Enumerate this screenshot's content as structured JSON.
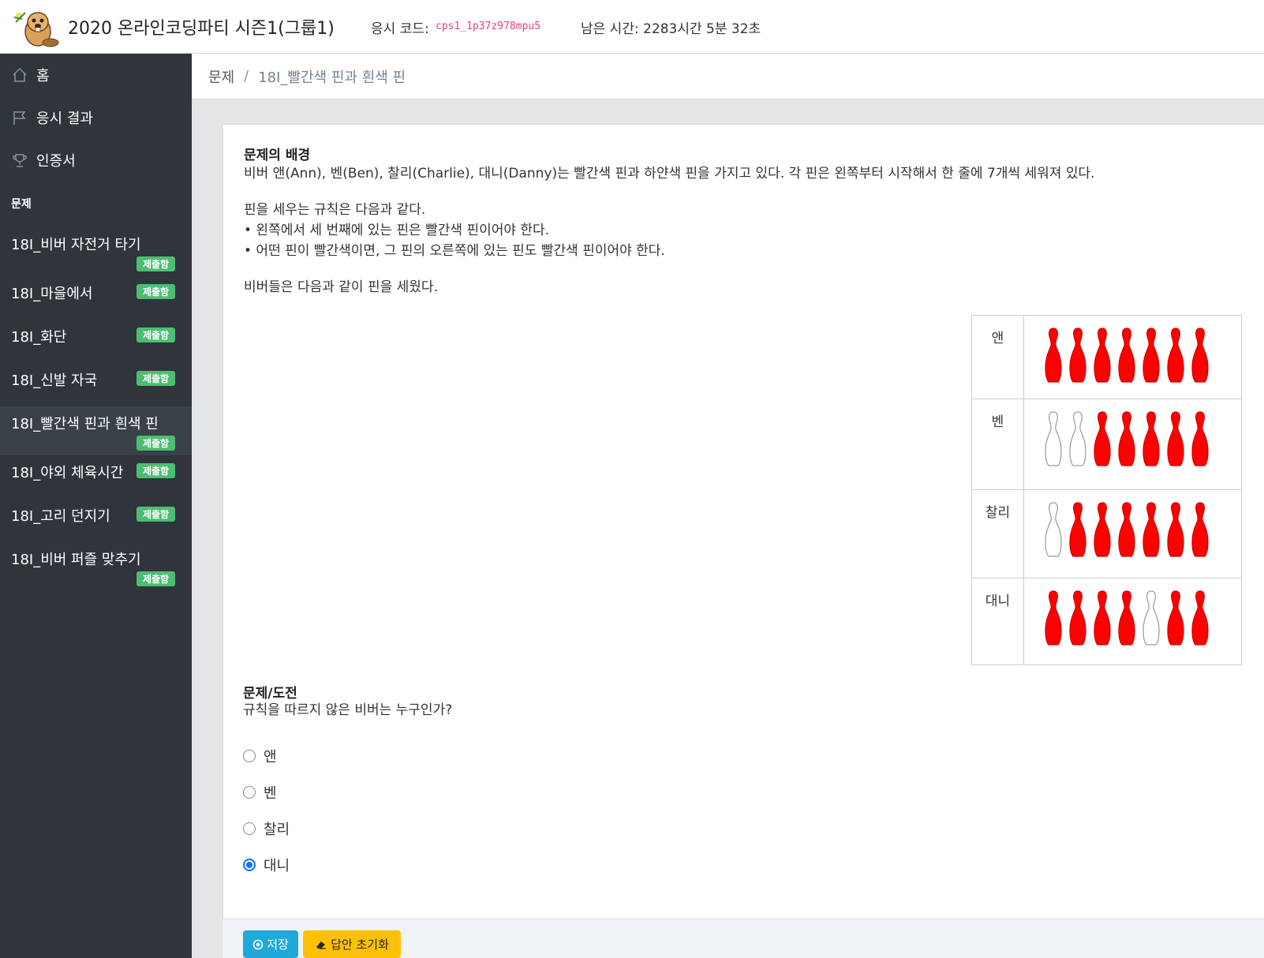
{
  "header": {
    "title": "2020 온라인코딩파티 시즌1(그룹1)",
    "code_label": "응시 코드:",
    "code_value": "cps1_1p37z978mpu5",
    "time_label": "남은 시간: 2283시간 5분 32초"
  },
  "sidebar": {
    "nav": [
      {
        "label": "홈",
        "icon": "home-icon"
      },
      {
        "label": "응시 결과",
        "icon": "flag-icon"
      },
      {
        "label": "인증서",
        "icon": "trophy-icon"
      }
    ],
    "section_title": "문제",
    "tasks": [
      {
        "label": "18I_비버 자전거 타기",
        "badge": "제출함"
      },
      {
        "label": "18I_마을에서",
        "badge": "제출함"
      },
      {
        "label": "18I_화단",
        "badge": "제출함"
      },
      {
        "label": "18I_신발 자국",
        "badge": "제출함"
      },
      {
        "label": "18I_빨간색 핀과 흰색 핀",
        "badge": "제출함",
        "active": true
      },
      {
        "label": "18I_야외 체육시간",
        "badge": "제출함"
      },
      {
        "label": "18I_고리 던지기",
        "badge": "제출함"
      },
      {
        "label": "18I_비버 퍼즐 맞추기",
        "badge": "제출함"
      }
    ]
  },
  "breadcrumb": {
    "root": "문제",
    "sep": "/",
    "current": "18I_빨간색 핀과 흰색 핀"
  },
  "problem": {
    "bg_title": "문제의 배경",
    "bg_text": "비버 앤(Ann), 벤(Ben), 찰리(Charlie), 대니(Danny)는 빨간색 핀과 하얀색 핀을 가지고 있다. 각 핀은 왼쪽부터 시작해서 한 줄에 7개씩 세워져 있다.",
    "rules_intro": "핀을 세우는 규칙은 다음과 같다.",
    "rule1": "• 왼쪽에서 세 번째에 있는 핀은 빨간색 핀이어야 한다.",
    "rule2": "• 어떤 핀이 빨간색이면, 그 핀의 오른쪽에 있는 핀도 빨간색 핀이어야 한다.",
    "setup": "비버들은 다음과 같이 핀을 세웠다.",
    "pins": [
      {
        "name": "앤",
        "colors": [
          "red",
          "red",
          "red",
          "red",
          "red",
          "red",
          "red"
        ]
      },
      {
        "name": "벤",
        "colors": [
          "white",
          "white",
          "red",
          "red",
          "red",
          "red",
          "red"
        ]
      },
      {
        "name": "찰리",
        "colors": [
          "white",
          "red",
          "red",
          "red",
          "red",
          "red",
          "red"
        ]
      },
      {
        "name": "대니",
        "colors": [
          "red",
          "red",
          "red",
          "red",
          "white",
          "red",
          "red"
        ]
      }
    ],
    "pin_colors": {
      "red": "#ff0000",
      "white": "#ffffff"
    },
    "q_title": "문제/도전",
    "q_text": "규칙을 따르지 않은 비버는 누구인가?",
    "options": [
      {
        "label": "앤",
        "checked": false
      },
      {
        "label": "벤",
        "checked": false
      },
      {
        "label": "찰리",
        "checked": false
      },
      {
        "label": "대니",
        "checked": true
      }
    ]
  },
  "footer": {
    "save_label": "저장",
    "reset_label": "답안 초기화"
  }
}
